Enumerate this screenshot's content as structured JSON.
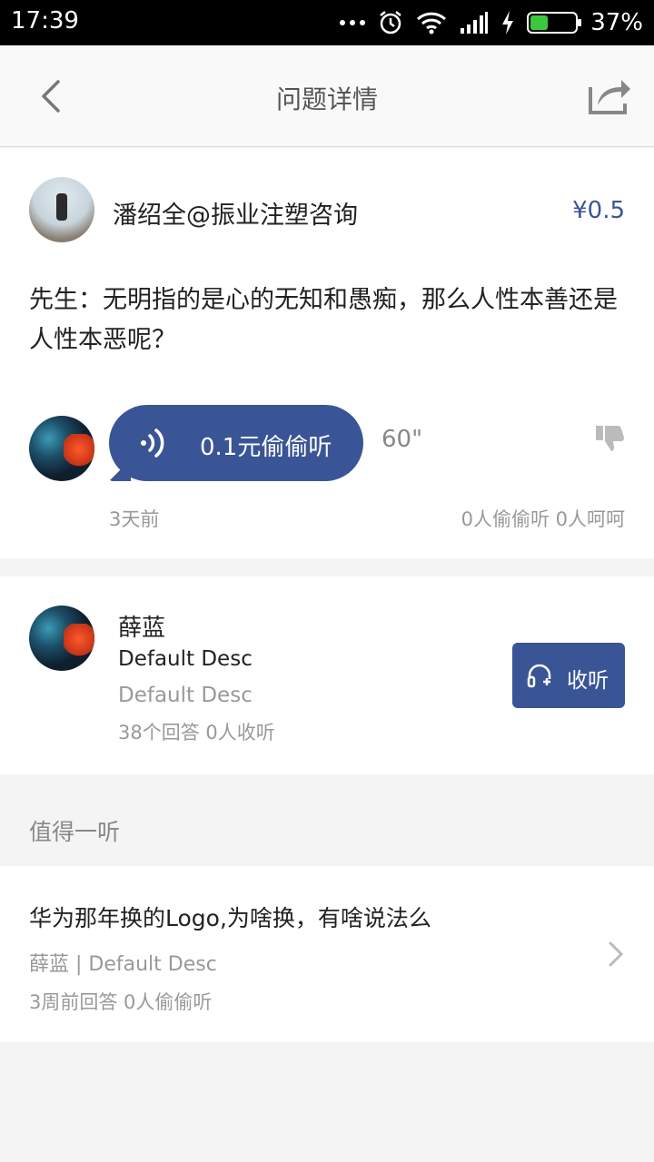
{
  "status_bar": {
    "time": "17:39",
    "battery": "37%",
    "battery_level": 0.37
  },
  "header": {
    "title": "问题详情"
  },
  "question": {
    "asker_name": "潘绍全@振业注塑咨询",
    "price": "¥0.5",
    "text": "先生：无明指的是心的无知和愚痴，那么人性本善还是人性本恶呢？",
    "answer": {
      "listen_label": "0.1元偷偷听",
      "duration": "60\"",
      "time_ago": "3天前",
      "stats": "0人偷偷听 0人呵呵"
    }
  },
  "expert": {
    "name": "薛蓝",
    "desc": "Default Desc",
    "desc_secondary": "Default Desc",
    "stats": "38个回答 0人收听",
    "listen_button": "收听"
  },
  "recommend": {
    "section_title": "值得一听",
    "items": [
      {
        "title": "华为那年换的Logo,为啥换，有啥说法么",
        "subtitle": "薛蓝 | Default Desc",
        "meta": "3周前回答  0人偷偷听"
      }
    ]
  },
  "colors": {
    "accent": "#3a5596"
  }
}
